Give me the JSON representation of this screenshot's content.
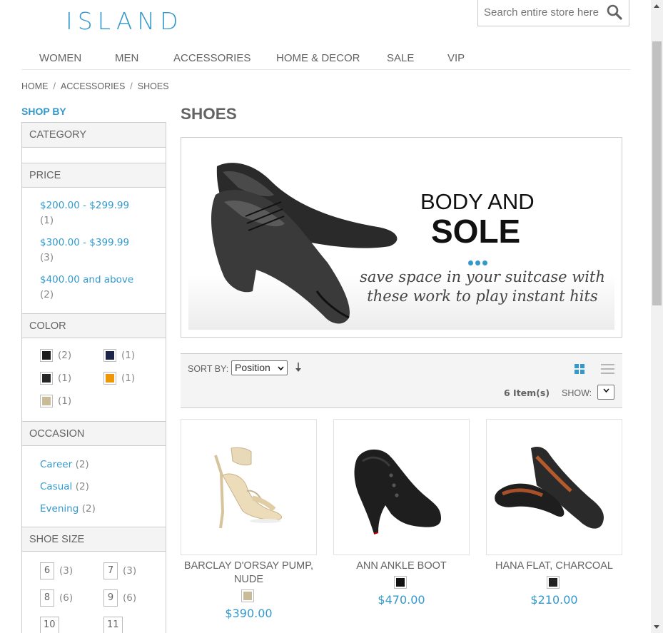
{
  "header": {
    "logo": "ISLAND",
    "search_placeholder": "Search entire store here..."
  },
  "nav": {
    "items": [
      "WOMEN",
      "MEN",
      "ACCESSORIES",
      "HOME & DECOR",
      "SALE",
      "VIP"
    ]
  },
  "breadcrumb": {
    "items": [
      "HOME",
      "ACCESSORIES",
      "SHOES"
    ],
    "separator": "/"
  },
  "sidebar": {
    "shop_by": "SHOP BY",
    "category": {
      "title": "CATEGORY"
    },
    "price": {
      "title": "PRICE",
      "ranges": [
        {
          "label": "$200.00 - $299.99",
          "count": "(1)"
        },
        {
          "label": "$300.00 - $399.99",
          "count": "(3)"
        },
        {
          "label": "$400.00 and above",
          "count": "(2)"
        }
      ]
    },
    "color": {
      "title": "COLOR",
      "swatches": [
        {
          "color": "#1a1a1a",
          "count": "(2)"
        },
        {
          "color": "#1c2448",
          "count": "(1)"
        },
        {
          "color": "#262626",
          "count": "(1)"
        },
        {
          "color": "#f0960a",
          "count": "(1)"
        },
        {
          "color": "#c9bb98",
          "count": "(1)"
        }
      ]
    },
    "occasion": {
      "title": "OCCASION",
      "items": [
        {
          "label": "Career",
          "count": "(2)"
        },
        {
          "label": "Casual",
          "count": "(2)"
        },
        {
          "label": "Evening",
          "count": "(2)"
        }
      ]
    },
    "shoe_size": {
      "title": "SHOE SIZE",
      "sizes": [
        {
          "label": "6",
          "count": "(3)"
        },
        {
          "label": "7",
          "count": "(3)"
        },
        {
          "label": "8",
          "count": "(6)"
        },
        {
          "label": "9",
          "count": "(6)"
        },
        {
          "label": "10",
          "count": ""
        },
        {
          "label": "11",
          "count": ""
        }
      ]
    }
  },
  "main": {
    "title": "SHOES",
    "banner": {
      "heading1": "BODY AND",
      "heading2": "SOLE",
      "tagline": "save space in your suitcase with these work to play instant hits"
    },
    "toolbar": {
      "sort_label": "SORT BY:",
      "sort_value": "Position",
      "items_count": "6 Item(s)",
      "show_label": "SHOW:"
    },
    "products": [
      {
        "name": "BARCLAY D'ORSAY PUMP, NUDE",
        "price": "$390.00",
        "swatch": "#c9bb98"
      },
      {
        "name": "ANN ANKLE BOOT",
        "price": "$470.00",
        "swatch": "#111111"
      },
      {
        "name": "HANA FLAT, CHARCOAL",
        "price": "$210.00",
        "swatch": "#222222"
      }
    ]
  },
  "colors": {
    "accent": "#3399cc",
    "text": "#636363",
    "border": "#cccccc",
    "panel": "#f4f4f4"
  }
}
